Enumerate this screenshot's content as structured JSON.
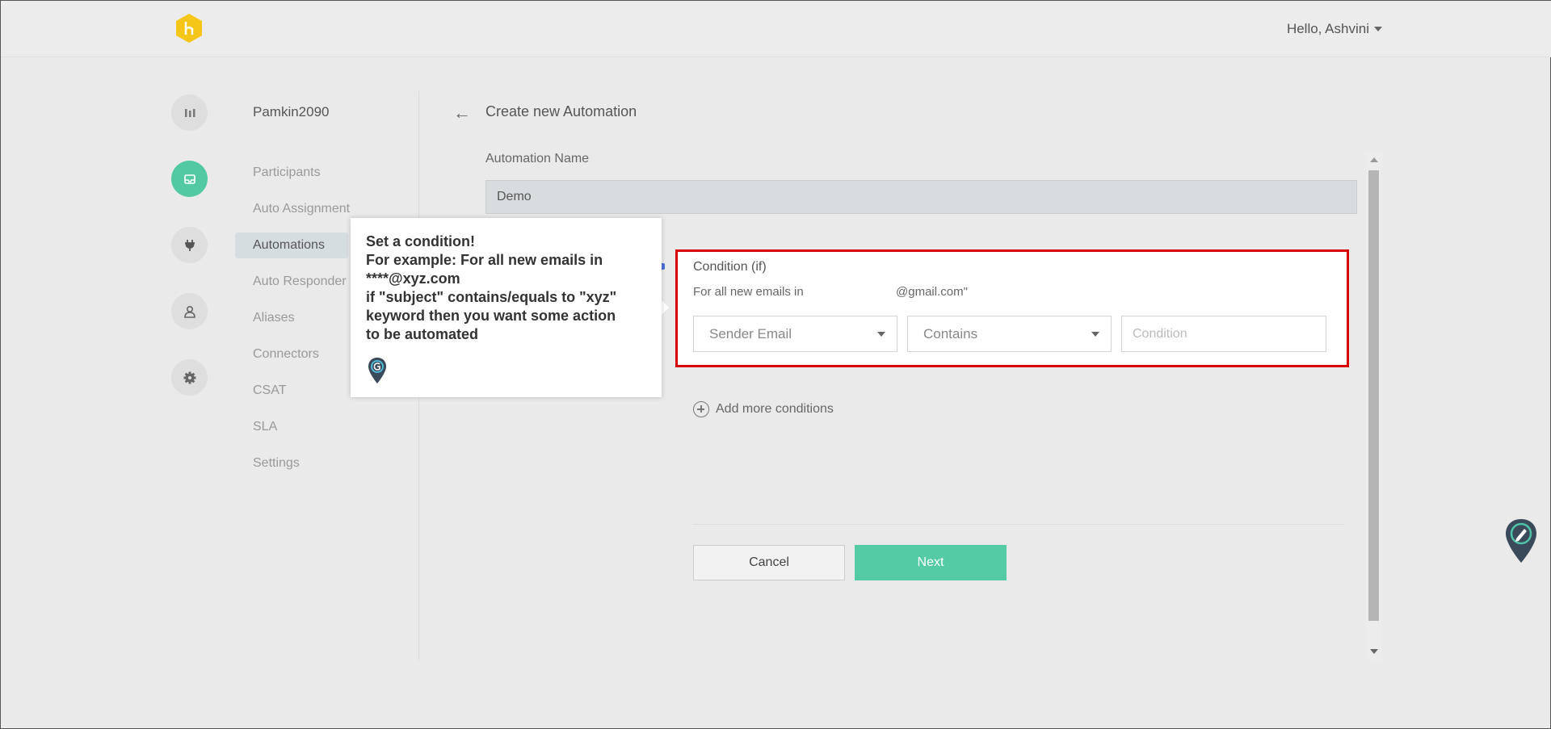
{
  "header": {
    "greeting": "Hello, Ashvini"
  },
  "workspace": {
    "name": "Pamkin2090"
  },
  "rail": [
    "reports-icon",
    "inbox-icon",
    "plug-icon",
    "user-icon",
    "gear-icon"
  ],
  "nav": {
    "items": [
      {
        "label": "Participants",
        "active": false
      },
      {
        "label": "Auto Assignment",
        "active": false
      },
      {
        "label": "Automations",
        "active": true
      },
      {
        "label": "Auto Responder",
        "active": false
      },
      {
        "label": "Aliases",
        "active": false
      },
      {
        "label": "Connectors",
        "active": false
      },
      {
        "label": "CSAT",
        "active": false
      },
      {
        "label": "SLA",
        "active": false
      },
      {
        "label": "Settings",
        "active": false
      }
    ]
  },
  "page": {
    "title": "Create new Automation"
  },
  "form": {
    "name_label": "Automation Name",
    "name_value": "Demo",
    "condition": {
      "title": "Condition (if)",
      "description": "For all new emails in",
      "domain": "@gmail.com\"",
      "field_select": "Sender Email",
      "operator_select": "Contains",
      "value_placeholder": "Condition"
    },
    "add_more_label": "Add more conditions",
    "cancel_label": "Cancel",
    "next_label": "Next"
  },
  "tooltip": {
    "line1": "Set a condition!",
    "line2": "For example: For all new emails in",
    "line3": "****@xyz.com",
    "line4": "if \"subject\" contains/equals to \"xyz\"",
    "line5": "keyword then you want some action",
    "line6": "to be automated"
  },
  "colors": {
    "accent": "#54cba4",
    "highlight": "#d60000",
    "logo": "#f5c518"
  }
}
